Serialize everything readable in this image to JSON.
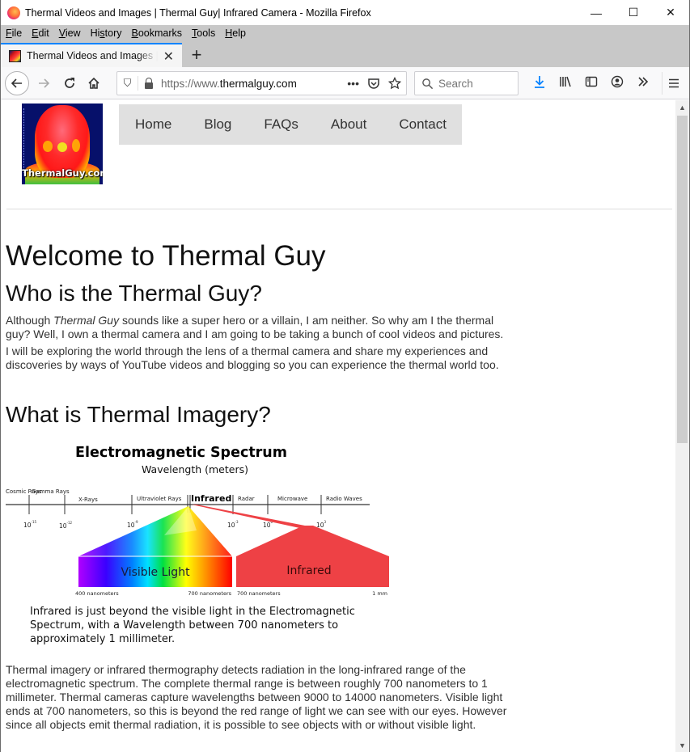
{
  "window": {
    "title": "Thermal Videos and Images | Thermal Guy| Infrared Camera - Mozilla Firefox",
    "controls": {
      "minimize": "—",
      "maximize": "☐",
      "close": "✕"
    }
  },
  "menubar": {
    "items": [
      {
        "label": "File",
        "key": "F",
        "rest": "ile"
      },
      {
        "label": "Edit",
        "key": "E",
        "rest": "dit"
      },
      {
        "label": "View",
        "key": "V",
        "rest": "iew"
      },
      {
        "label": "History",
        "key": "s",
        "pre": "Hi",
        "rest": "tory"
      },
      {
        "label": "Bookmarks",
        "key": "B",
        "rest": "ookmarks"
      },
      {
        "label": "Tools",
        "key": "T",
        "rest": "ools"
      },
      {
        "label": "Help",
        "key": "H",
        "rest": "elp"
      }
    ]
  },
  "tabs": [
    {
      "title": "Thermal Videos and Images | Thermal Guy| Infrared Camera",
      "active": true
    }
  ],
  "toolbar": {
    "new_tab": "+",
    "url_protocol": "https://www.",
    "url_domain": "thermalguy.com",
    "search_placeholder": "Search",
    "page_actions": "•••"
  },
  "site": {
    "logo_text": "ThermalGuy.com",
    "nav": [
      "Home",
      "Blog",
      "FAQs",
      "About",
      "Contact"
    ],
    "page_title": "Welcome to Thermal Guy",
    "section1": {
      "heading": "Who is the Thermal Guy?",
      "p1_before": "Although ",
      "p1_em": "Thermal Guy",
      "p1_after": " sounds like a super hero or a villain, I am neither. So why am I the thermal guy? Well, I own a thermal camera and I am going to be taking a bunch of cool videos and pictures.",
      "p2": "I will be exploring the world through the lens of a thermal camera and share my experiences and discoveries by ways of YouTube videos and blogging so you can experience the thermal world too."
    },
    "section2": {
      "heading": "What is Thermal Imagery?",
      "diagram": {
        "title": "Electromagnetic Spectrum",
        "subtitle": "Wavelength (meters)",
        "bands": [
          "Cosmic Rays",
          "Gamma Rays",
          "X-Rays",
          "Ultraviolet Rays",
          "Infrared",
          "Radar",
          "Microwave",
          "Radio Waves"
        ],
        "ticks": [
          {
            "base": "10",
            "exp": "-15"
          },
          {
            "base": "10",
            "exp": "-12"
          },
          {
            "base": "10",
            "exp": "-9"
          },
          {
            "base": "10",
            "exp": "-3"
          },
          {
            "base": "10",
            "exp": "0"
          },
          {
            "base": "10",
            "exp": "3"
          }
        ],
        "visible_label": "Visible Light",
        "infrared_label": "Infrared",
        "visible_range": [
          "400 nanometers",
          "700 nanometers"
        ],
        "infrared_range": [
          "700 nanometers",
          "1 mm"
        ],
        "caption": "Infrared is just beyond the visible light in the Electromagnetic Spectrum, with a Wavelength between 700 nanometers to approximately 1 millimeter."
      },
      "p3": "Thermal imagery or infrared thermography detects radiation in the long-infrared range of the electromagnetic spectrum. The complete thermal range is between roughly 700 nanometers to 1 millimeter. Thermal cameras capture wavelengths between 9000 to 14000 nanometers. Visible light ends at 700 nanometers, so this is beyond the red range of light we can see with our eyes. However since all objects emit thermal radiation, it is possible to see objects with or without visible light."
    }
  },
  "colors": {
    "accent": "#0a84ff",
    "infrared_red": "#ee4145",
    "nav_bg": "#e0e0e0"
  }
}
